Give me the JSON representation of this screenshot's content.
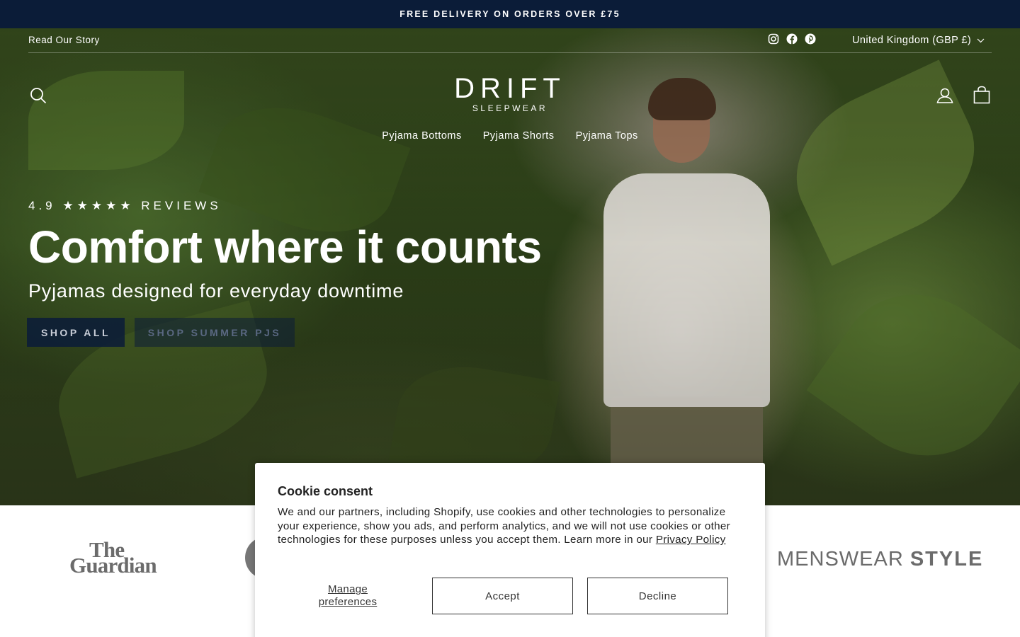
{
  "announcement": "FREE DELIVERY ON ORDERS OVER £75",
  "utility": {
    "story_link": "Read Our Story",
    "socials": [
      "instagram-icon",
      "facebook-icon",
      "pinterest-icon"
    ],
    "currency": "United Kingdom (GBP £)"
  },
  "header": {
    "logo_main": "DRIFT",
    "logo_sub": "SLEEPWEAR",
    "icons": [
      "search-icon",
      "account-icon",
      "cart-icon"
    ]
  },
  "nav": {
    "items": [
      "Pyjama Bottoms",
      "Pyjama Shorts",
      "Pyjama Tops"
    ]
  },
  "hero": {
    "reviews": "4.9 ★★★★★ REVIEWS",
    "headline": "Comfort where it counts",
    "subhead": "Pyjamas designed for everyday downtime",
    "button_shop_all": "SHOP ALL",
    "button_shop_summer": "SHOP SUMMER PJS"
  },
  "press": {
    "guardian_line1": "The",
    "guardian_line2": "Guardian",
    "menswear_light": "MENSWEAR ",
    "menswear_bold": "STYLE"
  },
  "cookie": {
    "title": "Cookie consent",
    "body": "We and our partners, including Shopify, use cookies and other technologies to personalize your experience, show you ads, and perform analytics, and we will not use cookies or other technologies for these purposes unless you accept them. Learn more in our ",
    "privacy_link": "Privacy Policy",
    "manage": "Manage preferences",
    "accept": "Accept",
    "decline": "Decline"
  },
  "colors": {
    "navy": "#0b1c38",
    "white": "#ffffff",
    "text_dark": "#222222"
  }
}
